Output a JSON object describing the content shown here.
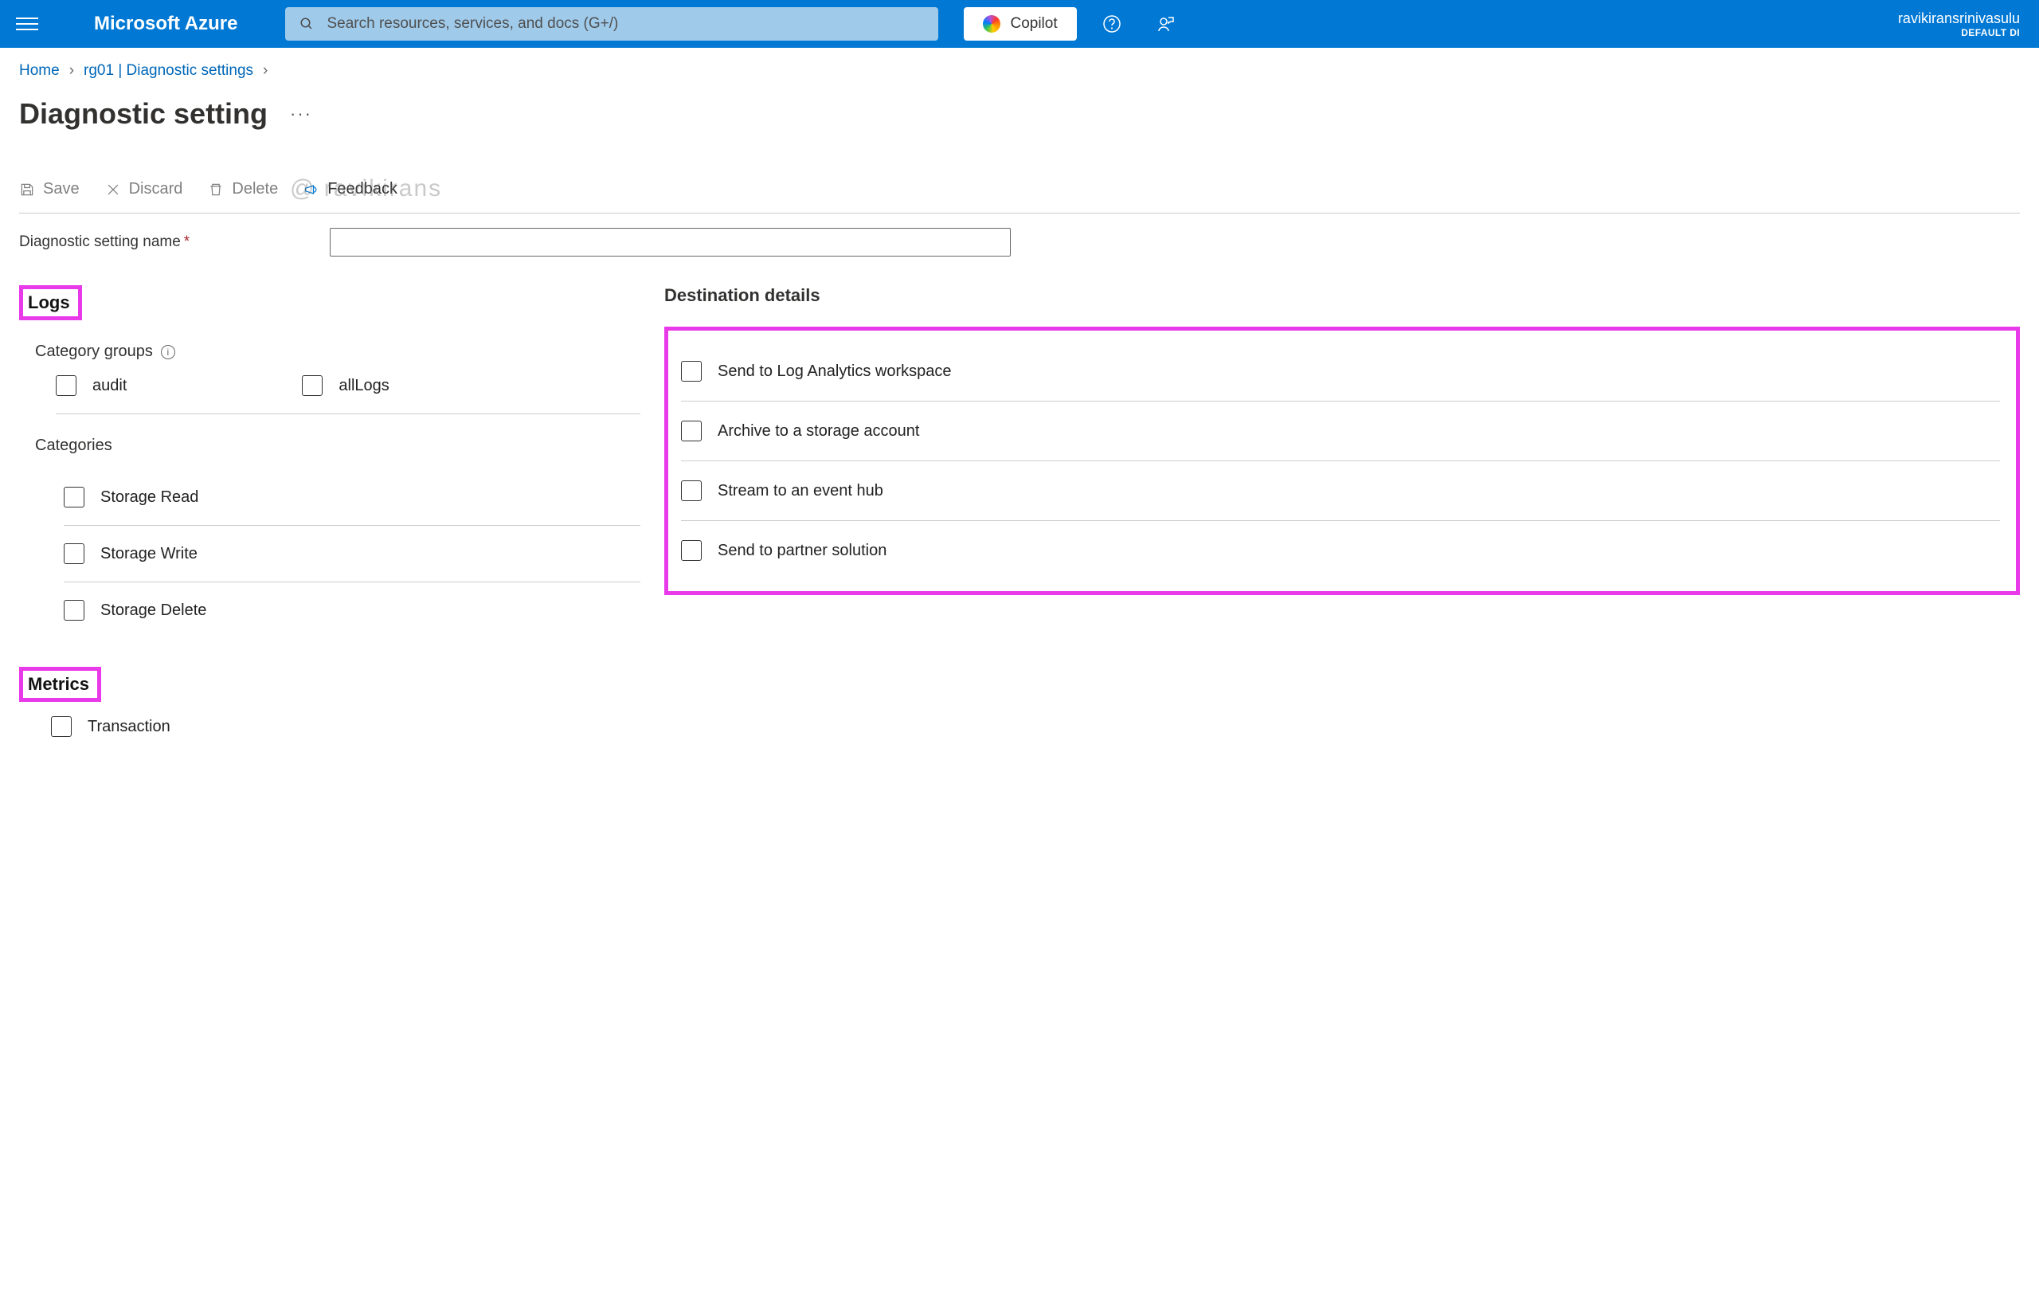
{
  "header": {
    "brand": "Microsoft Azure",
    "search_placeholder": "Search resources, services, and docs (G+/)",
    "copilot_label": "Copilot",
    "user_name": "ravikiransrinivasulu",
    "user_tenant": "DEFAULT DI"
  },
  "breadcrumb": {
    "home": "Home",
    "level1": "rg01 | Diagnostic settings"
  },
  "page": {
    "title": "Diagnostic setting"
  },
  "toolbar": {
    "save": "Save",
    "discard": "Discard",
    "delete": "Delete",
    "feedback": "Feedback"
  },
  "watermark": "@ ravikirans",
  "form": {
    "name_label": "Diagnostic setting name",
    "name_value": ""
  },
  "logs": {
    "heading": "Logs",
    "category_groups_label": "Category groups",
    "groups": {
      "audit": "audit",
      "allLogs": "allLogs"
    },
    "categories_label": "Categories",
    "categories": [
      "Storage Read",
      "Storage Write",
      "Storage Delete"
    ]
  },
  "metrics": {
    "heading": "Metrics",
    "items": [
      "Transaction"
    ]
  },
  "destination": {
    "heading": "Destination details",
    "items": [
      "Send to Log Analytics workspace",
      "Archive to a storage account",
      "Stream to an event hub",
      "Send to partner solution"
    ]
  }
}
